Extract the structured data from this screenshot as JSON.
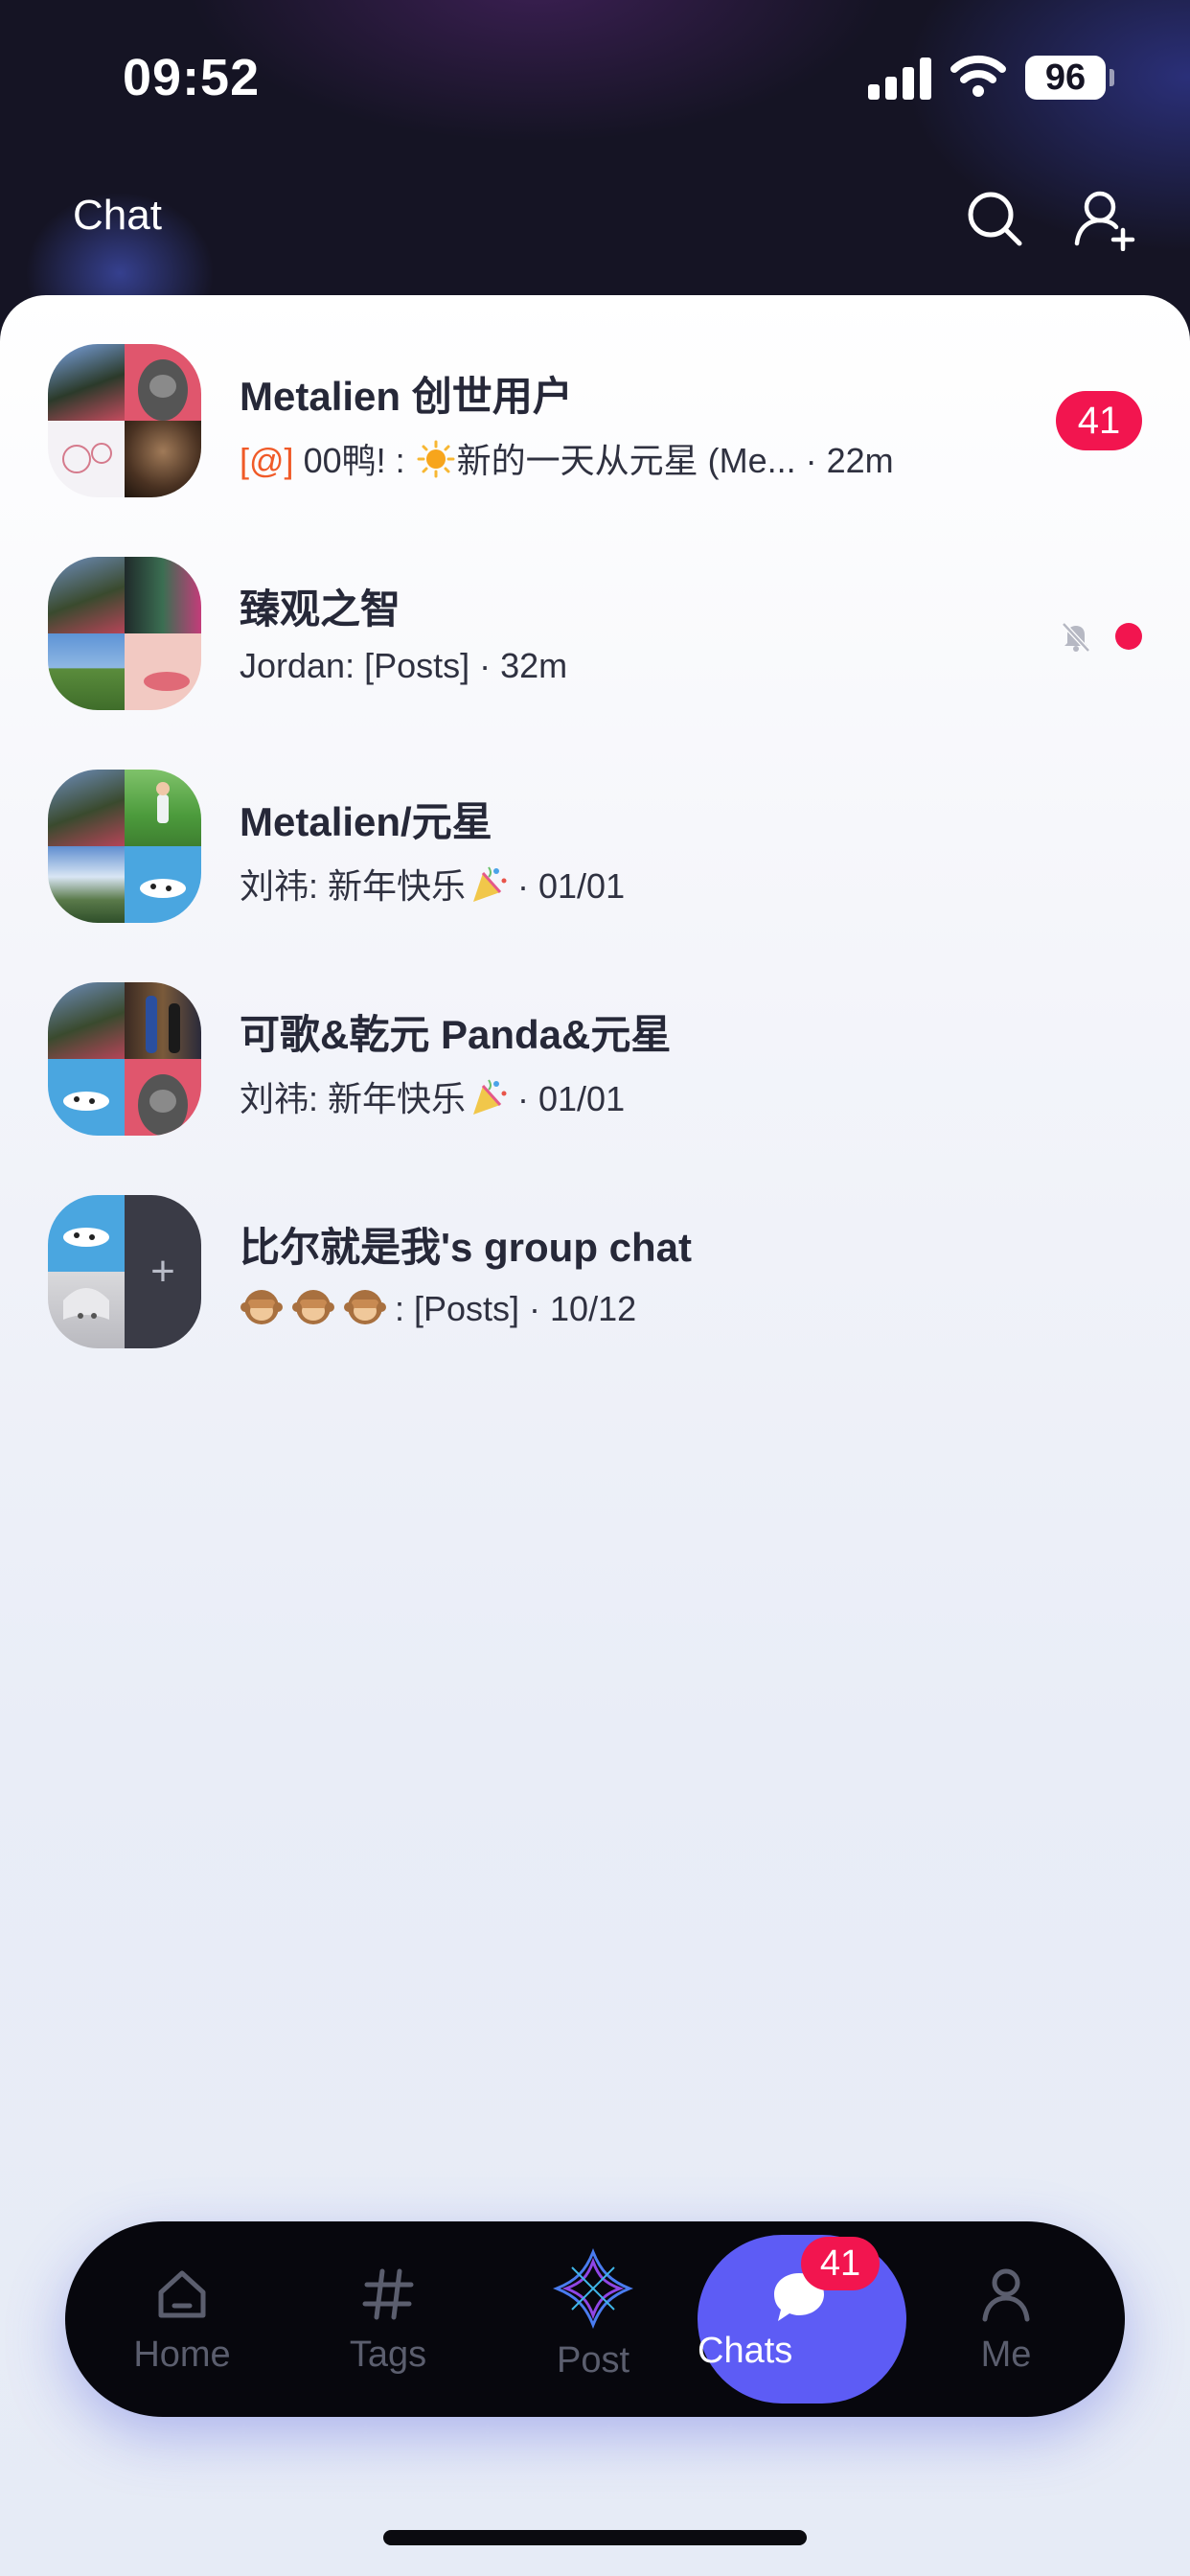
{
  "status_bar": {
    "time": "09:52",
    "battery": "96"
  },
  "header": {
    "title": "Chat"
  },
  "chats": [
    {
      "name": "Metalien 创世用户",
      "mention": "[@]",
      "preview_before_emoji": " 00鸭! : ",
      "preview_after_emoji": "新的一天从元星 (Me...",
      "time": " · 22m",
      "unread_count": "41"
    },
    {
      "name": "臻观之智",
      "preview": "Jordan: [Posts]",
      "time": " · 32m",
      "muted": true,
      "unread_dot": true
    },
    {
      "name": "Metalien/元星",
      "preview": "刘祎: 新年快乐",
      "time": " · 01/01"
    },
    {
      "name": "可歌&乾元 Panda&元星",
      "preview": "刘祎: 新年快乐",
      "time": " · 01/01"
    },
    {
      "name": "比尔就是我's group chat",
      "preview": ": [Posts]",
      "time": " · 10/12"
    }
  ],
  "tabbar": {
    "home": "Home",
    "tags": "Tags",
    "post": "Post",
    "chats": "Chats",
    "chats_badge": "41",
    "me": "Me"
  },
  "colors": {
    "accent": "#5d5cf5",
    "badge": "#f2154f",
    "mention": "#f05a28"
  },
  "icons": [
    "search-icon",
    "add-friend-icon",
    "mute-icon",
    "home-icon",
    "hashtag-icon",
    "post-logo-icon",
    "chat-bubble-icon",
    "person-icon"
  ]
}
